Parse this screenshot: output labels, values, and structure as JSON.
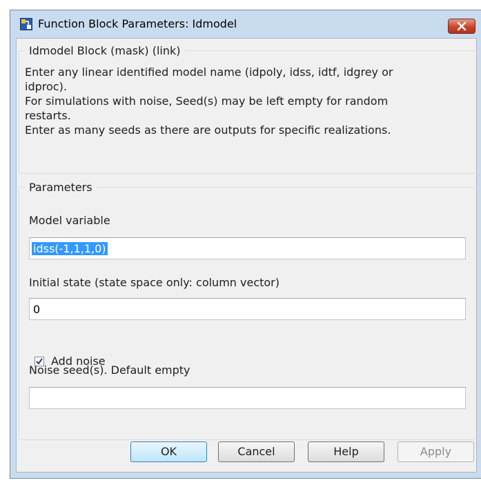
{
  "window": {
    "title": "Function Block Parameters: Idmodel"
  },
  "description": {
    "group_title": "Idmodel Block (mask) (link)",
    "lines": [
      "Enter any linear identified model name (idpoly, idss, idtf, idgrey or",
      "idproc).",
      "For simulations  with noise, Seed(s) may be left empty for random",
      "restarts.",
      "Enter as many seeds as there are outputs for specific realizations."
    ]
  },
  "parameters": {
    "group_title": "Parameters",
    "model_variable": {
      "label": "Model variable",
      "value": "idss(-1,1,1,0)",
      "selected": true
    },
    "initial_state": {
      "label": "Initial state (state space only: column vector)",
      "value": "0"
    },
    "add_noise": {
      "label": "Add noise",
      "checked": true
    },
    "noise_seed": {
      "label": "Noise seed(s).  Default empty",
      "value": ""
    }
  },
  "buttons": {
    "ok": "OK",
    "cancel": "Cancel",
    "help": "Help",
    "apply": "Apply"
  },
  "colors": {
    "selection": "#3399ff",
    "dialog_bg": "#f0f0f0",
    "frame": "#c9dcef",
    "close": "#c8452e"
  }
}
